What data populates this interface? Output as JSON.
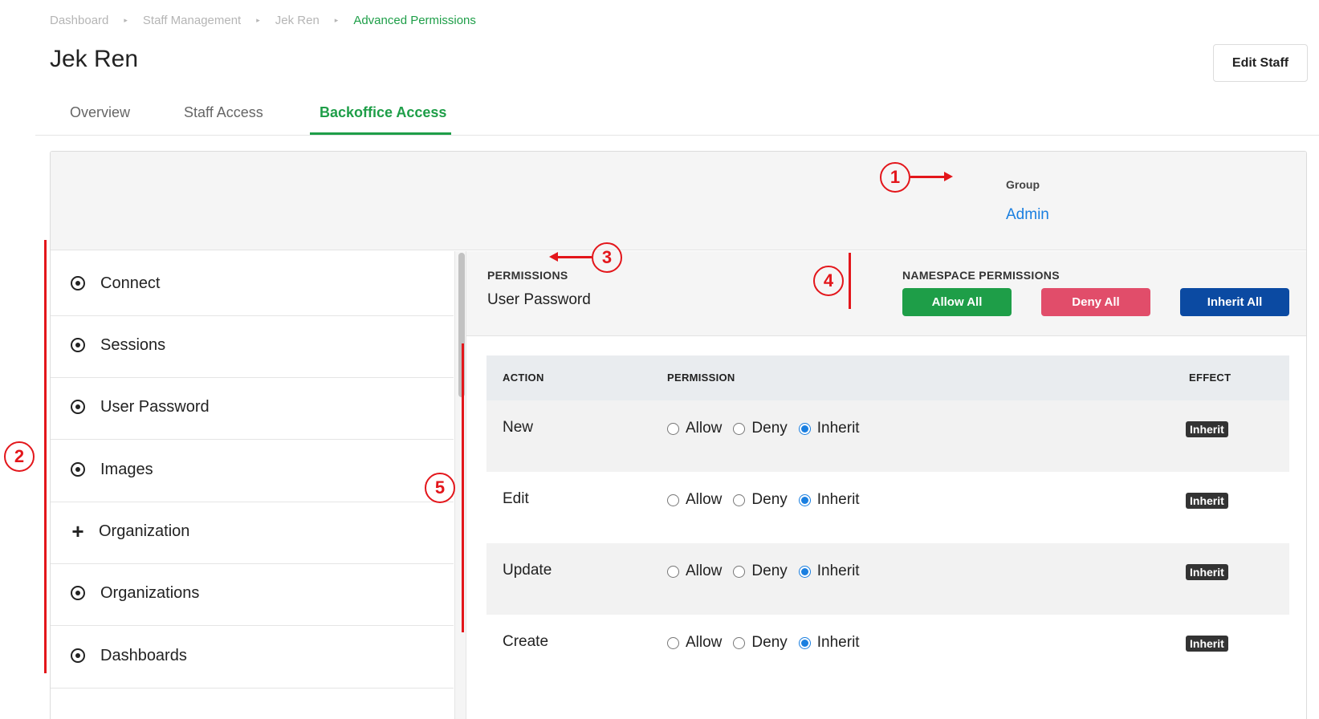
{
  "breadcrumb": [
    "Dashboard",
    "Staff Management",
    "Jek Ren",
    "Advanced Permissions"
  ],
  "page": {
    "title": "Jek Ren",
    "edit_button": "Edit Staff"
  },
  "tabs": [
    "Overview",
    "Staff Access",
    "Backoffice Access"
  ],
  "active_tab": "Backoffice Access",
  "group": {
    "label": "Group",
    "value": "Admin"
  },
  "sidebar": {
    "items": [
      {
        "label": "Connect",
        "icon": "target-icon"
      },
      {
        "label": "Sessions",
        "icon": "target-icon"
      },
      {
        "label": "User Password",
        "icon": "target-icon"
      },
      {
        "label": "Images",
        "icon": "target-icon"
      },
      {
        "label": "Organization",
        "icon": "plus-icon"
      },
      {
        "label": "Organizations",
        "icon": "target-icon"
      },
      {
        "label": "Dashboards",
        "icon": "target-icon"
      }
    ]
  },
  "permissions": {
    "title": "PERMISSIONS",
    "subtitle": "User Password"
  },
  "namespace": {
    "title": "NAMESPACE PERMISSIONS",
    "allow_all": "Allow All",
    "deny_all": "Deny All",
    "inherit_all": "Inherit All"
  },
  "table": {
    "headers": {
      "action": "ACTION",
      "permission": "PERMISSION",
      "effect": "EFFECT"
    },
    "options": [
      "Allow",
      "Deny",
      "Inherit"
    ],
    "rows": [
      {
        "action": "New",
        "selected": "Inherit",
        "effect": "Inherit"
      },
      {
        "action": "Edit",
        "selected": "Inherit",
        "effect": "Inherit"
      },
      {
        "action": "Update",
        "selected": "Inherit",
        "effect": "Inherit"
      },
      {
        "action": "Create",
        "selected": "Inherit",
        "effect": "Inherit"
      }
    ]
  },
  "annotations": [
    "1",
    "2",
    "3",
    "4",
    "5"
  ],
  "colors": {
    "accent_green": "#1e9e48",
    "deny_red": "#e14d6a",
    "inherit_blue": "#0b4aa2",
    "link_blue": "#1a7fe0",
    "annotation_red": "#e3161b"
  }
}
